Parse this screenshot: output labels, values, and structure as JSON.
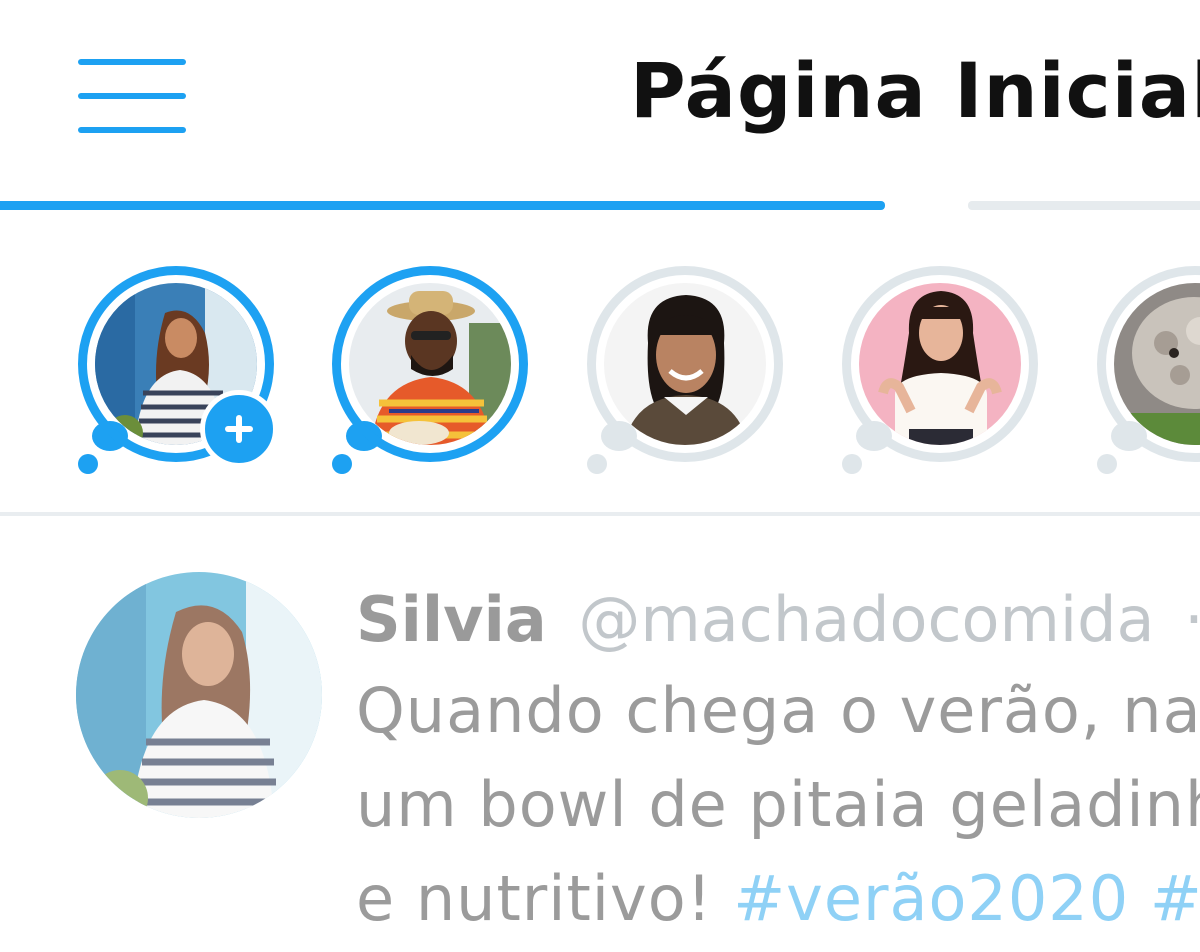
{
  "header": {
    "title": "Página Inicial",
    "menu_icon": "hamburger-menu-icon",
    "accent_color": "#1da1f2"
  },
  "tabs": {
    "active_index": 0,
    "count": 2
  },
  "stories": [
    {
      "name": "own-story",
      "state": "unseen",
      "add_button": true,
      "add_icon": "plus-icon"
    },
    {
      "name": "story-man-hat",
      "state": "unseen"
    },
    {
      "name": "story-woman-bangs",
      "state": "seen"
    },
    {
      "name": "story-woman-pink",
      "state": "seen"
    },
    {
      "name": "story-dog",
      "state": "seen"
    }
  ],
  "tweet": {
    "name": "Silvia",
    "handle": "@machadocomida",
    "separator": "·",
    "text_line1": "Quando chega o verão, na",
    "text_line2": "um bowl de pitaia geladinh",
    "text_line3_prefix": "e nutritivo! ",
    "hashtag1": "#verão2020",
    "hashtag2_partial": "#f"
  }
}
